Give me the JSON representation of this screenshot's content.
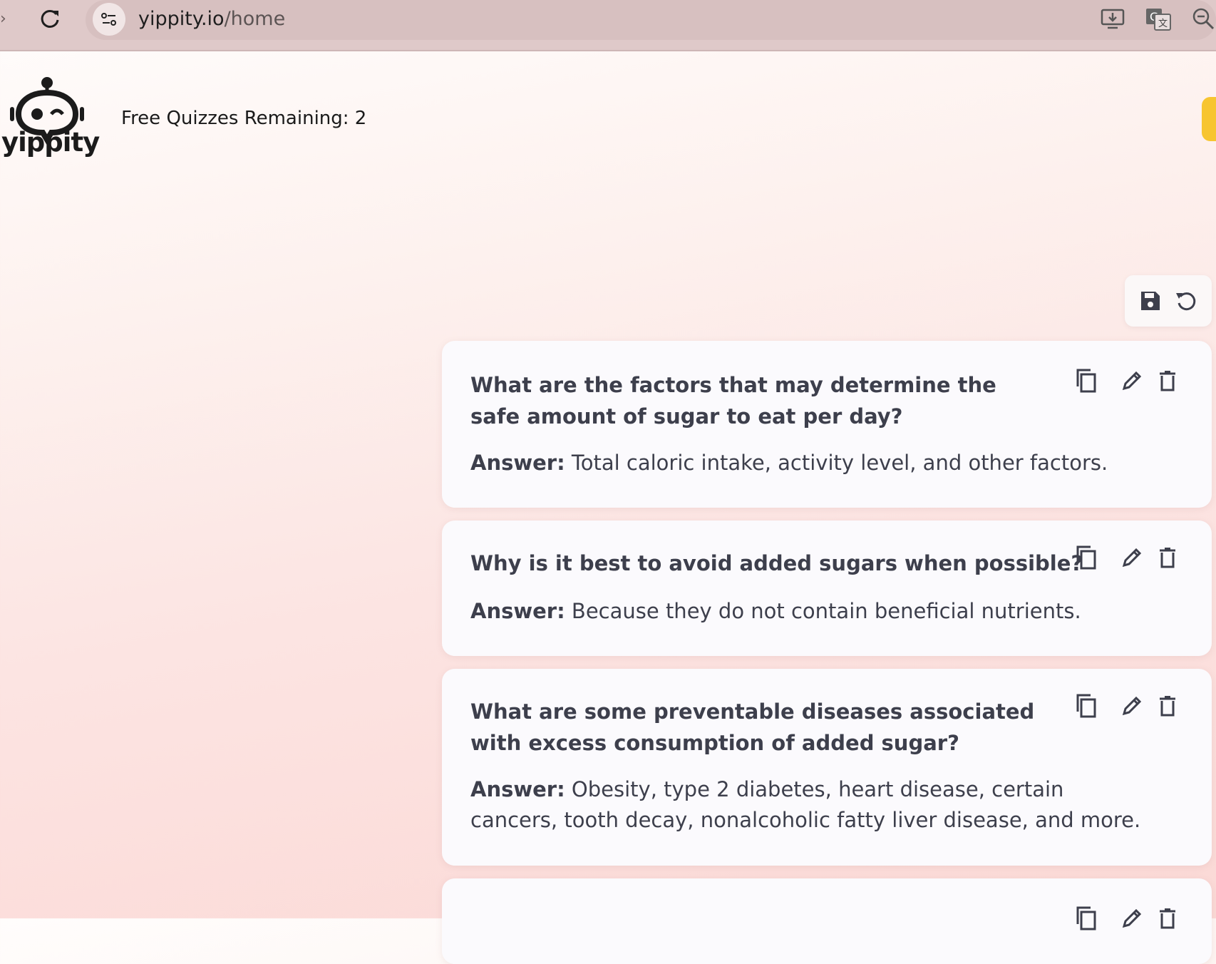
{
  "browser": {
    "url_host": "yippity.io",
    "url_path": "/home"
  },
  "header": {
    "logo_text": "yippity",
    "quota_text": "Free Quizzes Remaining: 2"
  },
  "toolbar": {
    "save_icon": "save-icon",
    "reset_icon": "reset-icon"
  },
  "questions": [
    {
      "question": "What are the factors that may determine the safe amount of sugar to eat per day?",
      "answer_label": "Answer:",
      "answer": " Total caloric intake, activity level, and other factors."
    },
    {
      "question": "Why is it best to avoid added sugars when possible?",
      "answer_label": "Answer:",
      "answer": " Because they do not contain beneficial nutrients."
    },
    {
      "question": "What are some preventable diseases associated with excess consumption of added sugar?",
      "answer_label": "Answer:",
      "answer": " Obesity, type 2 diabetes, heart disease, certain cancers, tooth decay, nonalcoholic fatty liver disease, and more."
    }
  ],
  "colors": {
    "accent": "#f7c530",
    "text": "#3d3f4c",
    "chrome": "#dfc9c9"
  }
}
